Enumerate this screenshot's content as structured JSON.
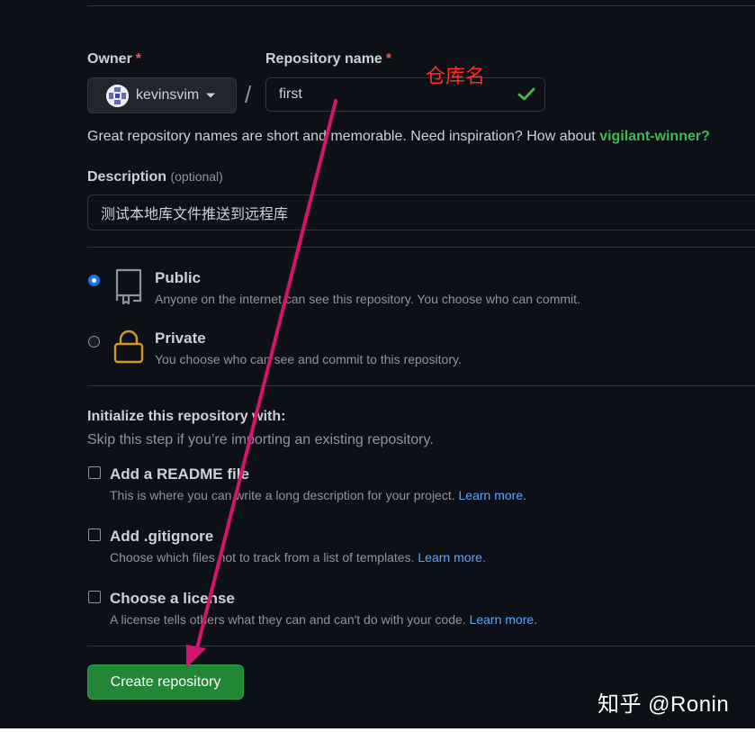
{
  "form": {
    "owner": {
      "label": "Owner",
      "required": "*",
      "value": "kevinsvim",
      "icon": "avatar"
    },
    "separator": "/",
    "repo_name": {
      "label": "Repository name",
      "required": "*",
      "value": "first",
      "valid_icon": "check-icon"
    },
    "name_hint": {
      "text": "Great repository names are short and memorable. Need inspiration? How about ",
      "suggestion": "vigilant-winner?"
    },
    "description": {
      "label": "Description",
      "optional": "(optional)",
      "value": "测试本地库文件推送到远程库"
    },
    "visibility": [
      {
        "title": "Public",
        "desc": "Anyone on the internet can see this repository. You choose who can commit.",
        "icon": "repo-icon",
        "selected": true
      },
      {
        "title": "Private",
        "desc": "You choose who can see and commit to this repository.",
        "icon": "lock-icon",
        "selected": false
      }
    ],
    "initialize": {
      "title": "Initialize this repository with:",
      "subtitle": "Skip this step if you’re importing an existing repository.",
      "options": [
        {
          "title": "Add a README file",
          "desc": "This is where you can write a long description for your project. ",
          "link": "Learn more."
        },
        {
          "title": "Add .gitignore",
          "desc": "Choose which files not to track from a list of templates. ",
          "link": "Learn more."
        },
        {
          "title": "Choose a license",
          "desc": "A license tells others what they can and can't do with your code. ",
          "link": "Learn more."
        }
      ]
    },
    "submit_label": "Create repository"
  },
  "annotation": {
    "text": "仓库名",
    "arrow_color": "#d4146e"
  },
  "watermark": "知乎 @Ronin",
  "colors": {
    "background": "#0d1117",
    "border": "#30363d",
    "text": "#c9d1d9",
    "muted": "#8b949e",
    "link": "#58a6ff",
    "success": "#3fb950",
    "button": "#238636",
    "required": "#f85149",
    "radio_selected": "#1f6feb",
    "private_icon": "#d29922",
    "annotation": "#ff2a2a",
    "arrow": "#d4146e"
  }
}
